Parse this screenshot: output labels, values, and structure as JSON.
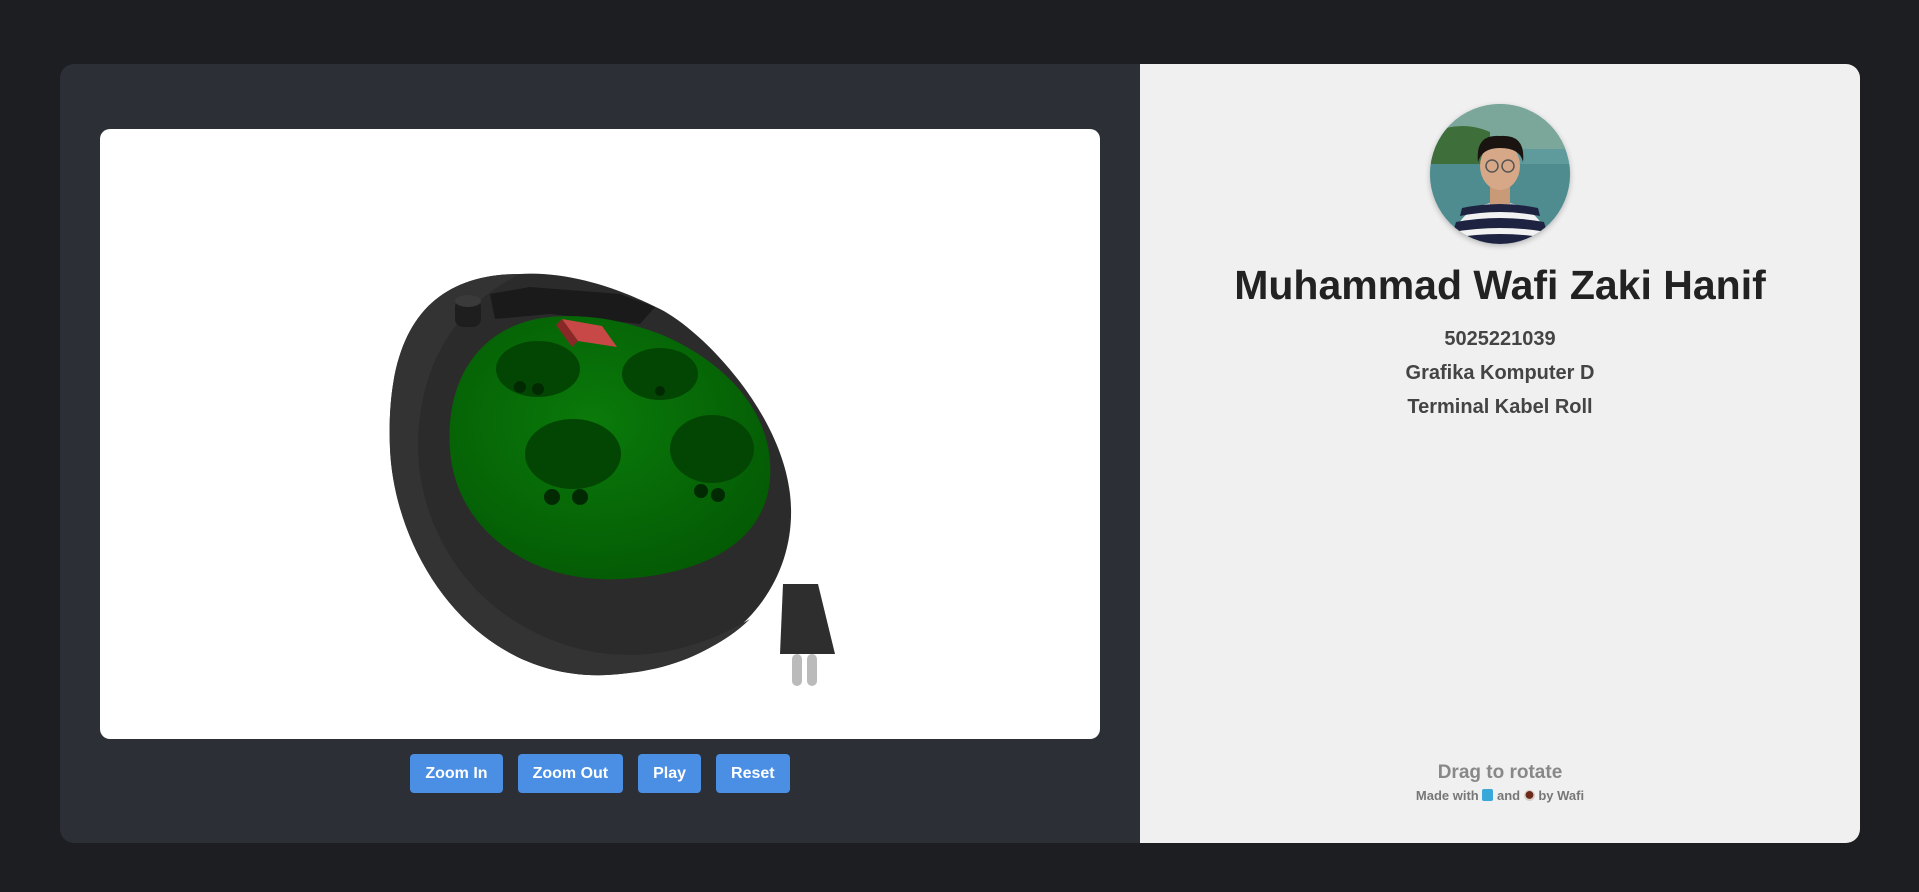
{
  "viewer": {
    "background_color": "#ffffff",
    "model": "terminal-kabel-roll"
  },
  "controls": {
    "zoom_in_label": "Zoom In",
    "zoom_out_label": "Zoom Out",
    "play_label": "Play",
    "reset_label": "Reset",
    "button_color": "#4a8fe4"
  },
  "profile": {
    "name": "Muhammad Wafi Zaki Hanif",
    "student_id": "5025221039",
    "course": "Grafika Komputer D",
    "project": "Terminal Kabel Roll"
  },
  "hint": {
    "drag_label": "Drag to rotate"
  },
  "footer": {
    "made_with": "Made with",
    "and": "and",
    "by": "by Wafi",
    "icon_1": "blue-book-icon",
    "icon_2": "coffee-icon"
  }
}
